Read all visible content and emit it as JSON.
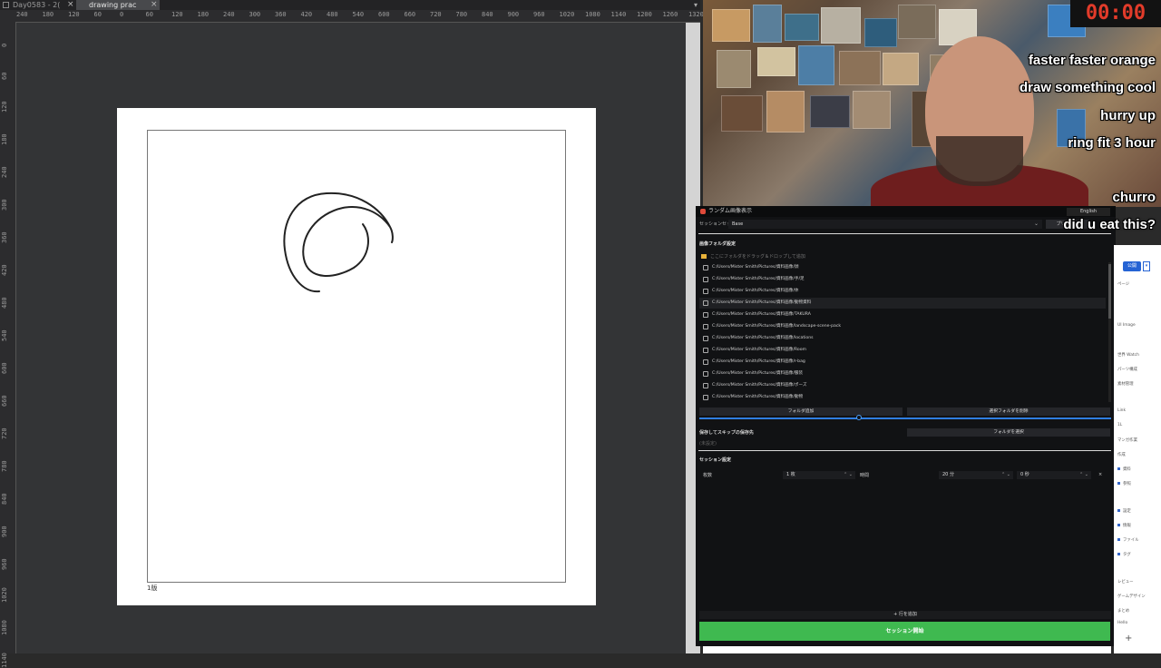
{
  "drawing_app": {
    "tabs": [
      {
        "label": "Day0583 - 2(",
        "close": "×"
      },
      {
        "label": "drawing prac BASE*",
        "close": "×"
      }
    ],
    "tab_menu_icon": "chevron-down-icon",
    "ruler_top_ticks": [
      "240",
      "180",
      "120",
      "60",
      "0",
      "60",
      "120",
      "180",
      "240",
      "300",
      "360",
      "420",
      "480",
      "540",
      "600",
      "660",
      "720",
      "780",
      "840",
      "900",
      "960",
      "1020",
      "1080",
      "1140",
      "1200",
      "1260",
      "1320"
    ],
    "ruler_left_ticks": [
      "0",
      "60",
      "120",
      "180",
      "240",
      "300",
      "360",
      "420",
      "480",
      "540",
      "600",
      "660",
      "720",
      "780",
      "840",
      "900",
      "960",
      "1020",
      "1080",
      "1140"
    ],
    "frame_label": "1版"
  },
  "stream_overlay": {
    "timer": "00:00",
    "chat_messages": [
      "faster faster orange",
      "draw something cool",
      "hurry up",
      "ring fit 3 hour",
      "churro",
      "did u eat this?"
    ]
  },
  "session_app": {
    "title": "ランダム画像表示",
    "language": "English",
    "preset_label": "セッションセット",
    "preset_value": "Base",
    "preset_button": "プリセット",
    "folders_section": "画像フォルダ設定",
    "drop_hint": "ここにフォルダをドラッグ＆ドロップして追加",
    "folders": [
      "C:/Users/Mister Smith/Pictures/資料画像/顔",
      "C:/Users/Mister Smith/Pictures/資料画像/手/足",
      "C:/Users/Mister Smith/Pictures/資料画像/体",
      "C:/Users/Mister Smith/Pictures/資料画像/動物資料",
      "C:/Users/Mister Smith/Pictures/資料画像/TAKURA",
      "C:/Users/Mister Smith/Pictures/資料画像/landscape-scene-pack",
      "C:/Users/Mister Smith/Pictures/資料画像/locations",
      "C:/Users/Mister Smith/Pictures/資料画像/Room",
      "C:/Users/Mister Smith/Pictures/資料画像/r-bag",
      "C:/Users/Mister Smith/Pictures/資料画像/服装",
      "C:/Users/Mister Smith/Pictures/資料画像/ポーズ",
      "C:/Users/Mister Smith/Pictures/資料画像/動物"
    ],
    "add_folder_button": "フォルダ追加",
    "remove_folder_button": "選択フォルダを削除",
    "skip_save_label": "保存してスキップの保存先",
    "skip_save_placeholder": "(未設定)",
    "choose_folder_button": "フォルダを選択",
    "session_section": "セッション設定",
    "count_label": "枚数",
    "count_value": "1 枚",
    "time_label": "時間",
    "minutes_value": "20 分",
    "seconds_value": "0 秒",
    "add_row_button": "+ 行を追加",
    "start_button": "セッション開始"
  },
  "browser": {
    "button": "公開",
    "items": [
      "ページ",
      "ビューア",
      "UI Image",
      "世界 Watch",
      "パーツ構成",
      "素材管理",
      "Link",
      "1L",
      "マンガ作業",
      "作成",
      "資料",
      "参照",
      "設定",
      "情報",
      "ファイル",
      "タグ",
      "レビュー",
      "ゲームデザイン",
      "まとめ",
      "Hello"
    ]
  },
  "colors": {
    "accent_green": "#3fb950",
    "timer_red": "#e23b2a",
    "session_bg": "#111214"
  }
}
